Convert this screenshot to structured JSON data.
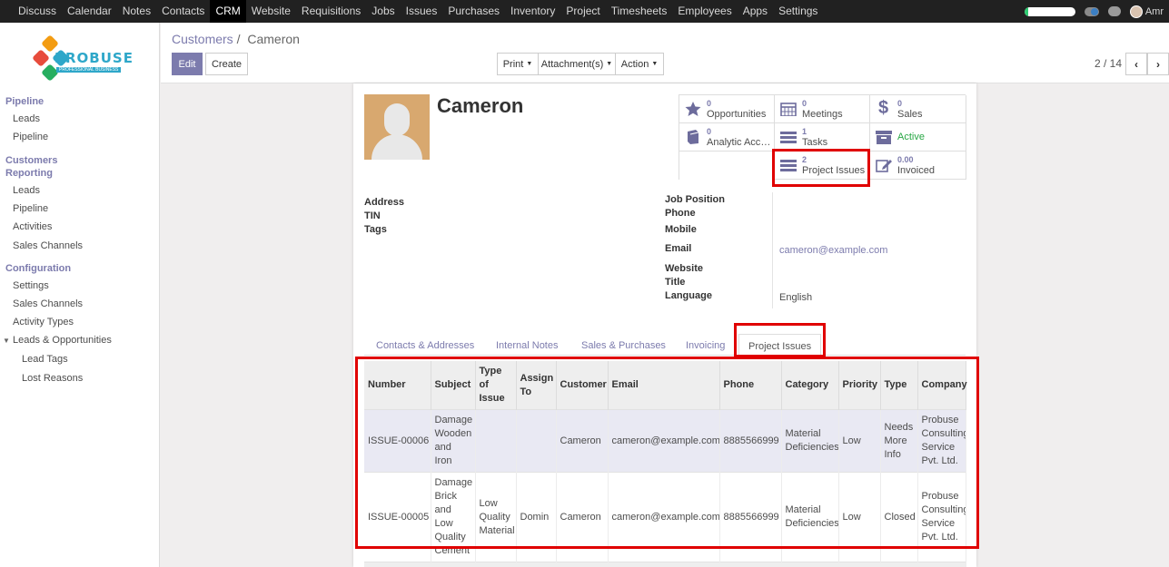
{
  "topbar": {
    "menu": [
      "Discuss",
      "Calendar",
      "Notes",
      "Contacts",
      "CRM",
      "Website",
      "Requisitions",
      "Jobs",
      "Issues",
      "Purchases",
      "Inventory",
      "Project",
      "Timesheets",
      "Employees",
      "Apps",
      "Settings"
    ],
    "active_menu": "CRM",
    "user_name": "Amr",
    "chat_count": "5"
  },
  "sidebar": {
    "logo_text": "PROBUSE",
    "logo_sub": "PROFESSIONAL BUSINESS",
    "pipeline_title": "Pipeline",
    "pipeline_items": [
      "Leads",
      "Pipeline"
    ],
    "reporting_title_1": "Customers",
    "reporting_title_2": "Reporting",
    "reporting_items": [
      "Leads",
      "Pipeline",
      "Activities",
      "Sales Channels"
    ],
    "config_title": "Configuration",
    "config_items": [
      "Settings",
      "Sales Channels",
      "Activity Types"
    ],
    "config_group": "Leads & Opportunities",
    "config_group_items": [
      "Lead Tags",
      "Lost Reasons"
    ]
  },
  "control": {
    "breadcrumb_parent": "Customers",
    "breadcrumb_sep": "/",
    "breadcrumb_current": "Cameron",
    "edit_label": "Edit",
    "create_label": "Create",
    "print_label": "Print",
    "attachments_label": "Attachment(s)",
    "action_label": "Action",
    "pager_value": "2 / 14"
  },
  "partner": {
    "name": "Cameron",
    "smart_buttons": {
      "opportunities": {
        "num": "0",
        "label": "Opportunities"
      },
      "meetings": {
        "num": "0",
        "label": "Meetings"
      },
      "sales": {
        "num": "0",
        "label": "Sales"
      },
      "analytic": {
        "num": "0",
        "label": "Analytic Acco..."
      },
      "tasks": {
        "num": "1",
        "label": "Tasks"
      },
      "active": {
        "label": "Active"
      },
      "project_issues": {
        "num": "2",
        "label": "Project Issues"
      },
      "invoiced": {
        "num": "0.00",
        "label": "Invoiced"
      }
    },
    "labels": {
      "address": "Address",
      "tin": "TIN",
      "tags": "Tags",
      "job_position": "Job Position",
      "phone": "Phone",
      "mobile": "Mobile",
      "email": "Email",
      "website": "Website",
      "title": "Title",
      "language": "Language"
    },
    "values": {
      "email": "cameron@example.com",
      "language": "English"
    }
  },
  "tabs": [
    "Contacts & Addresses",
    "Internal Notes",
    "Sales & Purchases",
    "Invoicing",
    "Project Issues"
  ],
  "active_tab": "Project Issues",
  "issues": {
    "headers": [
      "Number",
      "Subject",
      "Type of Issue",
      "Assign To",
      "Customer",
      "Email",
      "Phone",
      "Category",
      "Priority",
      "Type",
      "Company"
    ],
    "rows": [
      [
        "ISSUE-00006",
        "Damage Wooden and Iron",
        "",
        "",
        "Cameron",
        "cameron@example.com",
        "8885566999",
        "Material Deficiencies",
        "Low",
        "Needs More Info",
        "Probuse Consulting Service Pvt. Ltd."
      ],
      [
        "ISSUE-00005",
        "Damage Brick and Low Quality Cement",
        "Low Quality Material",
        "Domin",
        "Cameron",
        "cameron@example.com",
        "8885566999",
        "Material Deficiencies",
        "Low",
        "Closed",
        "Probuse Consulting Service Pvt. Ltd."
      ]
    ]
  },
  "colors": {
    "accent": "#7c7bad",
    "highlight": "#e00000",
    "navbar": "#212121",
    "active_status": "#28a745"
  }
}
